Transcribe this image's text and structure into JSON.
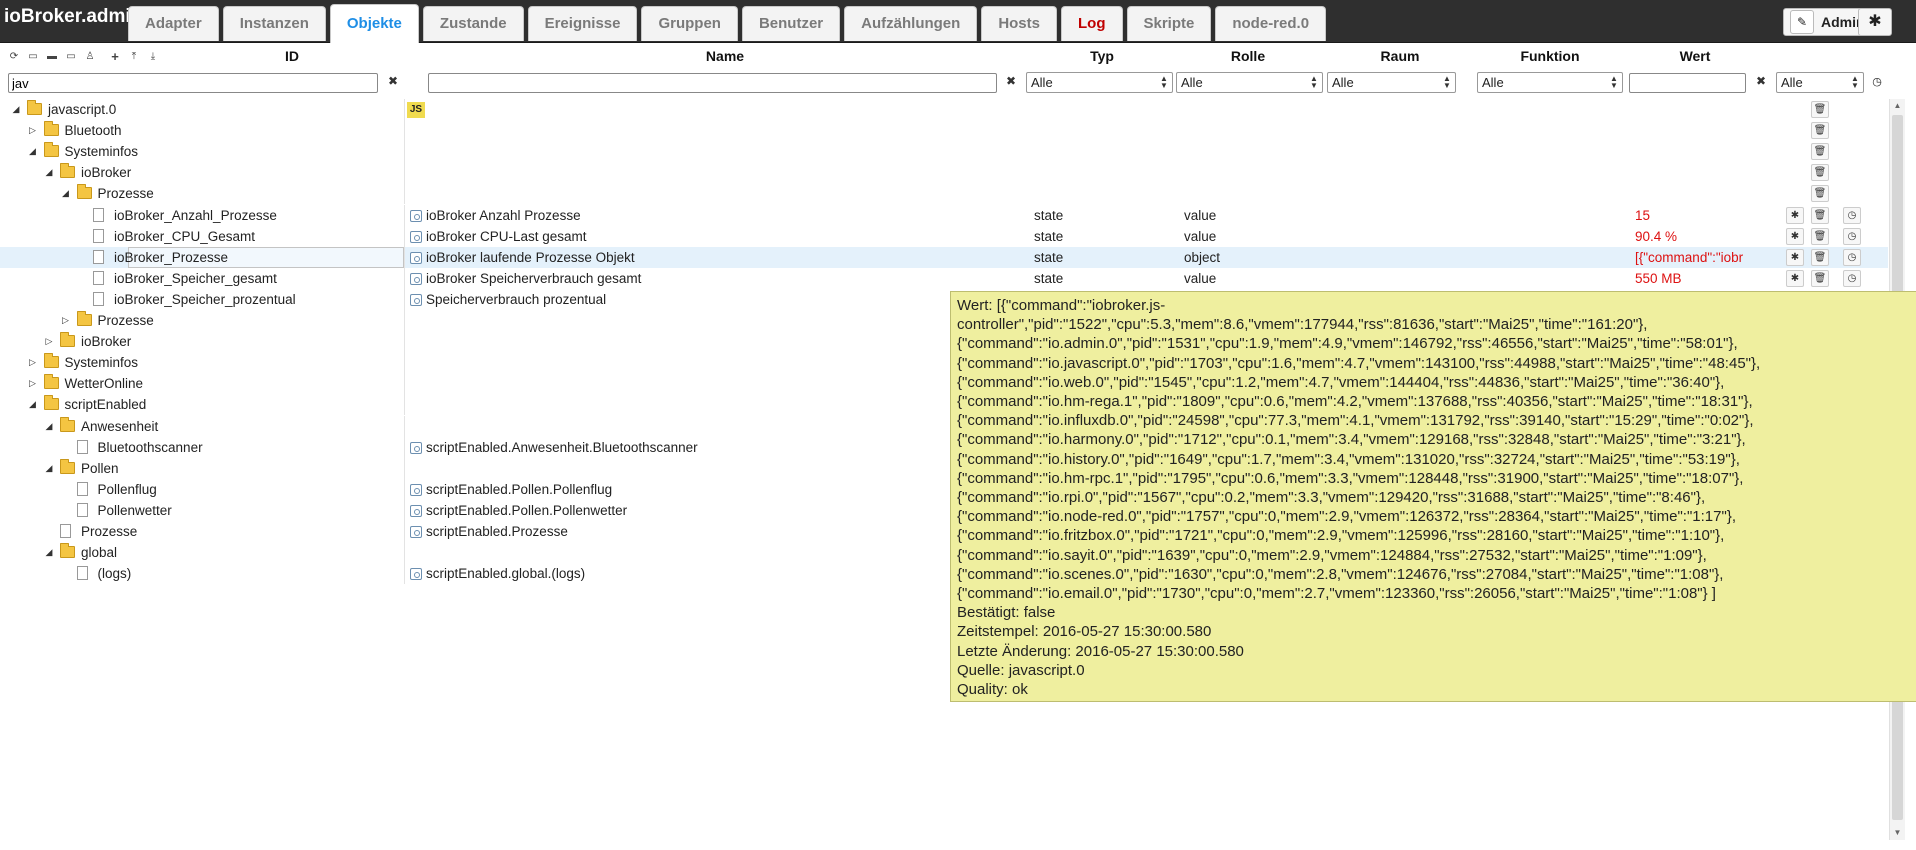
{
  "app": {
    "title": "ioBroker.admin",
    "user": "Admin"
  },
  "tabs": [
    {
      "label": "Adapter",
      "active": false,
      "red": false
    },
    {
      "label": "Instanzen",
      "active": false,
      "red": false
    },
    {
      "label": "Objekte",
      "active": true,
      "red": false
    },
    {
      "label": "Zustande",
      "active": false,
      "red": false
    },
    {
      "label": "Ereignisse",
      "active": false,
      "red": false
    },
    {
      "label": "Gruppen",
      "active": false,
      "red": false
    },
    {
      "label": "Benutzer",
      "active": false,
      "red": false
    },
    {
      "label": "Aufzählungen",
      "active": false,
      "red": false
    },
    {
      "label": "Hosts",
      "active": false,
      "red": false
    },
    {
      "label": "Log",
      "active": false,
      "red": true
    },
    {
      "label": "Skripte",
      "active": false,
      "red": false
    },
    {
      "label": "node-red.0",
      "active": false,
      "red": false
    }
  ],
  "columns": {
    "id": "ID",
    "name": "Name",
    "typ": "Typ",
    "rolle": "Rolle",
    "raum": "Raum",
    "funktion": "Funktion",
    "wert": "Wert"
  },
  "filters": {
    "id_value": "jav",
    "name_value": "",
    "wert_value": "",
    "typ_selected": "Alle",
    "rolle_selected": "Alle",
    "raum_selected": "Alle",
    "funktion_selected": "Alle",
    "wert_type_selected": "Alle"
  },
  "tree": [
    {
      "label": "javascript.0",
      "depth": 0,
      "kind": "folder",
      "toggle": "open",
      "badge": "JS",
      "name": "",
      "typ": "",
      "rolle": "",
      "wert": "",
      "actions": 1,
      "selected": false
    },
    {
      "label": "Bluetooth",
      "depth": 1,
      "kind": "folder",
      "toggle": "closed",
      "name": "",
      "typ": "",
      "rolle": "",
      "wert": "",
      "actions": 1,
      "selected": false
    },
    {
      "label": "Systeminfos",
      "depth": 1,
      "kind": "folder",
      "toggle": "open",
      "name": "",
      "typ": "",
      "rolle": "",
      "wert": "",
      "actions": 1,
      "selected": false
    },
    {
      "label": "ioBroker",
      "depth": 2,
      "kind": "folder",
      "toggle": "open",
      "name": "",
      "typ": "",
      "rolle": "",
      "wert": "",
      "actions": 1,
      "selected": false
    },
    {
      "label": "Prozesse",
      "depth": 3,
      "kind": "folder",
      "toggle": "open",
      "name": "",
      "typ": "",
      "rolle": "",
      "wert": "",
      "actions": 1,
      "selected": false
    },
    {
      "label": "ioBroker_Anzahl_Prozesse",
      "depth": 4,
      "kind": "file",
      "toggle": "",
      "name": "ioBroker Anzahl Prozesse",
      "typ": "state",
      "rolle": "value",
      "wert": "15",
      "actions": 3,
      "selected": false
    },
    {
      "label": "ioBroker_CPU_Gesamt",
      "depth": 4,
      "kind": "file",
      "toggle": "",
      "name": "ioBroker CPU-Last gesamt",
      "typ": "state",
      "rolle": "value",
      "wert": "90.4 %",
      "actions": 3,
      "selected": false
    },
    {
      "label": "ioBroker_Prozesse",
      "depth": 4,
      "kind": "file",
      "toggle": "",
      "name": "ioBroker laufende Prozesse Objekt",
      "typ": "state",
      "rolle": "object",
      "wert": "[{\"command\":\"iobr",
      "actions": 3,
      "selected": true
    },
    {
      "label": "ioBroker_Speicher_gesamt",
      "depth": 4,
      "kind": "file",
      "toggle": "",
      "name": "ioBroker Speicherverbrauch gesamt",
      "typ": "state",
      "rolle": "value",
      "wert": "550 MB",
      "actions": 3,
      "selected": false
    },
    {
      "label": "ioBroker_Speicher_prozentual",
      "depth": 4,
      "kind": "file",
      "toggle": "",
      "name": "Speicherverbrauch prozentual",
      "typ": "",
      "rolle": "",
      "wert": "",
      "actions": 0,
      "selected": false
    },
    {
      "label": "Prozesse",
      "depth": 3,
      "kind": "folder",
      "toggle": "closed",
      "name": "",
      "typ": "",
      "rolle": "",
      "wert": "",
      "actions": 0,
      "selected": false
    },
    {
      "label": "ioBroker",
      "depth": 2,
      "kind": "folder",
      "toggle": "closed",
      "name": "",
      "typ": "",
      "rolle": "",
      "wert": "",
      "actions": 0,
      "selected": false
    },
    {
      "label": "Systeminfos",
      "depth": 1,
      "kind": "folder",
      "toggle": "closed",
      "name": "",
      "typ": "",
      "rolle": "",
      "wert": "",
      "actions": 0,
      "selected": false
    },
    {
      "label": "WetterOnline",
      "depth": 1,
      "kind": "folder",
      "toggle": "closed",
      "name": "",
      "typ": "",
      "rolle": "",
      "wert": "",
      "actions": 0,
      "selected": false
    },
    {
      "label": "scriptEnabled",
      "depth": 1,
      "kind": "folder",
      "toggle": "open",
      "name": "",
      "typ": "",
      "rolle": "",
      "wert": "",
      "actions": 0,
      "selected": false
    },
    {
      "label": "Anwesenheit",
      "depth": 2,
      "kind": "folder",
      "toggle": "open",
      "name": "",
      "typ": "",
      "rolle": "",
      "wert": "",
      "actions": 0,
      "selected": false
    },
    {
      "label": "Bluetoothscanner",
      "depth": 3,
      "kind": "file",
      "toggle": "",
      "name": "scriptEnabled.Anwesenheit.Bluetoothscanner",
      "typ": "",
      "rolle": "",
      "wert": "",
      "actions": 0,
      "selected": false
    },
    {
      "label": "Pollen",
      "depth": 2,
      "kind": "folder",
      "toggle": "open",
      "name": "",
      "typ": "",
      "rolle": "",
      "wert": "",
      "actions": 0,
      "selected": false
    },
    {
      "label": "Pollenflug",
      "depth": 3,
      "kind": "file",
      "toggle": "",
      "name": "scriptEnabled.Pollen.Pollenflug",
      "typ": "",
      "rolle": "",
      "wert": "",
      "actions": 0,
      "selected": false
    },
    {
      "label": "Pollenwetter",
      "depth": 3,
      "kind": "file",
      "toggle": "",
      "name": "scriptEnabled.Pollen.Pollenwetter",
      "typ": "",
      "rolle": "",
      "wert": "",
      "actions": 0,
      "selected": false
    },
    {
      "label": "Prozesse",
      "depth": 2,
      "kind": "file",
      "toggle": "",
      "name": "scriptEnabled.Prozesse",
      "typ": "",
      "rolle": "",
      "wert": "",
      "actions": 0,
      "selected": false
    },
    {
      "label": "global",
      "depth": 2,
      "kind": "folder",
      "toggle": "open",
      "name": "",
      "typ": "",
      "rolle": "",
      "wert": "",
      "actions": 0,
      "selected": false
    },
    {
      "label": "(logs)",
      "depth": 3,
      "kind": "file",
      "toggle": "",
      "name": "scriptEnabled.global.(logs)",
      "typ": "",
      "rolle": "",
      "wert": "",
      "actions": 0,
      "selected": false
    }
  ],
  "tooltip": {
    "lines": [
      "Wert: [{\"command\":\"iobroker.js-",
      "controller\",\"pid\":\"1522\",\"cpu\":5.3,\"mem\":8.6,\"vmem\":177944,\"rss\":81636,\"start\":\"Mai25\",\"time\":\"161:20\"},",
      "{\"command\":\"io.admin.0\",\"pid\":\"1531\",\"cpu\":1.9,\"mem\":4.9,\"vmem\":146792,\"rss\":46556,\"start\":\"Mai25\",\"time\":\"58:01\"},",
      "{\"command\":\"io.javascript.0\",\"pid\":\"1703\",\"cpu\":1.6,\"mem\":4.7,\"vmem\":143100,\"rss\":44988,\"start\":\"Mai25\",\"time\":\"48:45\"},",
      "{\"command\":\"io.web.0\",\"pid\":\"1545\",\"cpu\":1.2,\"mem\":4.7,\"vmem\":144404,\"rss\":44836,\"start\":\"Mai25\",\"time\":\"36:40\"},",
      "{\"command\":\"io.hm-rega.1\",\"pid\":\"1809\",\"cpu\":0.6,\"mem\":4.2,\"vmem\":137688,\"rss\":40356,\"start\":\"Mai25\",\"time\":\"18:31\"},",
      "{\"command\":\"io.influxdb.0\",\"pid\":\"24598\",\"cpu\":77.3,\"mem\":4.1,\"vmem\":131792,\"rss\":39140,\"start\":\"15:29\",\"time\":\"0:02\"},",
      "{\"command\":\"io.harmony.0\",\"pid\":\"1712\",\"cpu\":0.1,\"mem\":3.4,\"vmem\":129168,\"rss\":32848,\"start\":\"Mai25\",\"time\":\"3:21\"},",
      "{\"command\":\"io.history.0\",\"pid\":\"1649\",\"cpu\":1.7,\"mem\":3.4,\"vmem\":131020,\"rss\":32724,\"start\":\"Mai25\",\"time\":\"53:19\"},",
      "{\"command\":\"io.hm-rpc.1\",\"pid\":\"1795\",\"cpu\":0.6,\"mem\":3.3,\"vmem\":128448,\"rss\":31900,\"start\":\"Mai25\",\"time\":\"18:07\"},",
      "{\"command\":\"io.rpi.0\",\"pid\":\"1567\",\"cpu\":0.2,\"mem\":3.3,\"vmem\":129420,\"rss\":31688,\"start\":\"Mai25\",\"time\":\"8:46\"},",
      "{\"command\":\"io.node-red.0\",\"pid\":\"1757\",\"cpu\":0,\"mem\":2.9,\"vmem\":126372,\"rss\":28364,\"start\":\"Mai25\",\"time\":\"1:17\"},",
      "{\"command\":\"io.fritzbox.0\",\"pid\":\"1721\",\"cpu\":0,\"mem\":2.9,\"vmem\":125996,\"rss\":28160,\"start\":\"Mai25\",\"time\":\"1:10\"},",
      "{\"command\":\"io.sayit.0\",\"pid\":\"1639\",\"cpu\":0,\"mem\":2.9,\"vmem\":124884,\"rss\":27532,\"start\":\"Mai25\",\"time\":\"1:09\"},",
      "{\"command\":\"io.scenes.0\",\"pid\":\"1630\",\"cpu\":0,\"mem\":2.8,\"vmem\":124676,\"rss\":27084,\"start\":\"Mai25\",\"time\":\"1:08\"},",
      "{\"command\":\"io.email.0\",\"pid\":\"1730\",\"cpu\":0,\"mem\":2.7,\"vmem\":123360,\"rss\":26056,\"start\":\"Mai25\",\"time\":\"1:08\"} ]",
      "Bestätigt: false",
      "Zeitstempel: 2016-05-27 15:30:00.580",
      "Letzte Änderung: 2016-05-27 15:30:00.580",
      "Quelle: javascript.0",
      "Quality: ok"
    ]
  },
  "icons": {
    "refresh": "refresh-icon",
    "collapse": "collapse-icon",
    "folder_closed": "folder-closed-icon",
    "folder_open": "folder-open-icon",
    "user": "user-icon",
    "add": "add-icon",
    "upload": "upload-icon",
    "download": "download-icon",
    "delete": "trash-icon",
    "settings": "gear-icon",
    "history": "clock-icon",
    "edit": "pencil-icon"
  },
  "colors": {
    "topbar": "#2f2f2f",
    "active_tab": "#1e8ee6",
    "log_tab": "#c00000",
    "value_text": "#dd1111",
    "tooltip_bg": "#efef9f",
    "js_badge": "#f0db4f",
    "folder": "#f4c542"
  }
}
